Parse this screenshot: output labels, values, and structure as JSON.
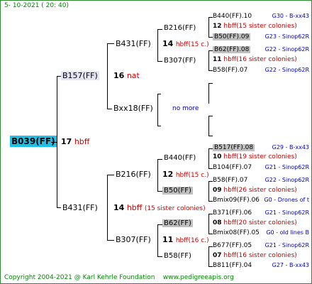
{
  "header": {
    "date": "5- 10-2021 ( 20: 40)"
  },
  "footer": {
    "copyright": "Copyright 2004-2021 @ Karl Kehrle Foundation",
    "site": "www.pedigreeapis.org"
  },
  "tree": {
    "root": {
      "name": "B039(FF)",
      "num": "17",
      "nat": "hbff"
    },
    "gen1": [
      {
        "name": "B157(FF)",
        "num": "16",
        "nat": "nat"
      },
      {
        "name": "B431(FF)",
        "num": "14",
        "nat": "hbff",
        "sisters": "(15 sister colonies)"
      }
    ],
    "gen2": [
      {
        "name": "B431(FF)",
        "num": "14",
        "nat": "hbff",
        "sisters": "(15 c.)"
      },
      {
        "name": "Bxx18(FF)",
        "nomore": "no more"
      },
      {
        "name": "B216(FF)",
        "num": "12",
        "nat": "hbff",
        "sisters": "(15 c.)"
      },
      {
        "name": "B307(FF)",
        "num": "11",
        "nat": "hbff",
        "sisters": "(16 c.)"
      }
    ],
    "gen3": [
      {
        "name": "B216(FF)",
        "num": "12",
        "nat": "hbff",
        "sisters": "(15 sister colonies)"
      },
      {
        "name": "B307(FF)",
        "num": "11",
        "nat": "hbff",
        "sisters": "(16 sister colonies)"
      },
      {
        "name": "B440(FF)",
        "num": "10",
        "nat": "hbff",
        "sisters": "(19 sister colonies)"
      },
      {
        "name": "B50(FF)",
        "num": "09",
        "nat": "hbff",
        "sisters": "(26 sister colonies)"
      },
      {
        "name": "B62(FF)",
        "num": "08",
        "nat": "hbff",
        "sisters": "(20 sister colonies)"
      },
      {
        "name": "B58(FF)",
        "num": "07",
        "nat": "hbff",
        "sisters": "(16 sister colonies)"
      }
    ],
    "gen4": [
      {
        "name": "B440(FF).10",
        "info": "G30 - B-xx43"
      },
      {
        "name": "B50(FF).09",
        "info": "G23 - Sinop62R"
      },
      {
        "name": "B62(FF).08",
        "info": "G22 - Sinop62R"
      },
      {
        "name": "B58(FF).07",
        "info": "G22 - Sinop62R"
      },
      {
        "name": "B517(FF).08",
        "info": "G29 - B-xx43"
      },
      {
        "name": "B104(FF).07",
        "info": "G21 - Sinop62R"
      },
      {
        "name": "B58(FF).07",
        "info": "G22 - Sinop62R"
      },
      {
        "name": "Bmix09(FF).06",
        "info": "G0 - Drones of t"
      },
      {
        "name": "B371(FF).06",
        "info": "G21 - Sinop62R"
      },
      {
        "name": "Bmix08(FF).05",
        "info": "G0 - old lines B"
      },
      {
        "name": "B677(FF).05",
        "info": "G21 - Sinop62R"
      },
      {
        "name": "B811(FF).04",
        "info": "G27 - B-xx43"
      }
    ]
  }
}
